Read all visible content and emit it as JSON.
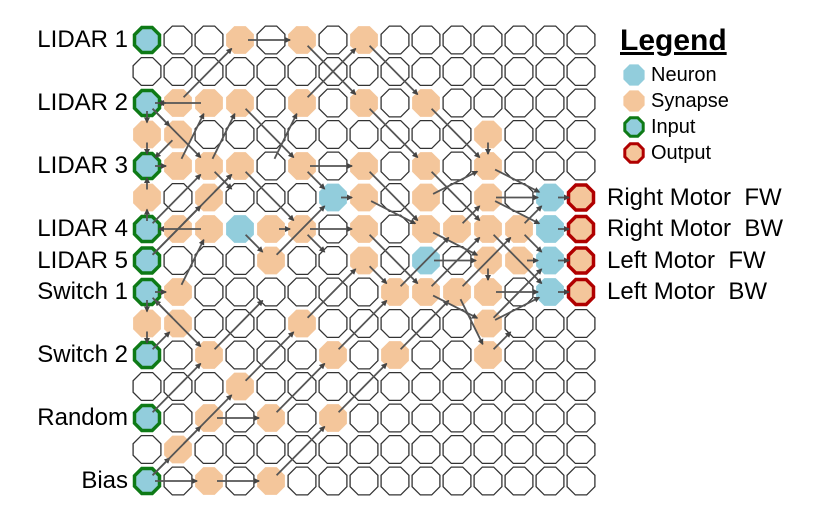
{
  "legend": {
    "title": "Legend",
    "items": [
      {
        "key": "N",
        "label": "Neuron",
        "icon": "neuron-icon"
      },
      {
        "key": "S",
        "label": "Synapse",
        "icon": "synapse-icon"
      },
      {
        "key": "I",
        "label": "Input",
        "icon": "input-icon"
      },
      {
        "key": "O",
        "label": "Output",
        "icon": "output-icon"
      }
    ]
  },
  "colors": {
    "neuron_fill": "#92CDDC",
    "synapse_fill": "#F4C69B",
    "input_border": "#0E7A16",
    "output_border": "#B00000",
    "empty_border": "#333333",
    "edge": "#555555"
  },
  "input_labels": [
    {
      "row": 0,
      "label": "LIDAR 1"
    },
    {
      "row": 2,
      "label": "LIDAR 2"
    },
    {
      "row": 4,
      "label": "LIDAR 3"
    },
    {
      "row": 6,
      "label": "LIDAR 4"
    },
    {
      "row": 7,
      "label": "LIDAR 5"
    },
    {
      "row": 8,
      "label": "Switch 1"
    },
    {
      "row": 10,
      "label": "Switch 2"
    },
    {
      "row": 12,
      "label": "Random"
    },
    {
      "row": 14,
      "label": "Bias"
    }
  ],
  "output_labels": [
    {
      "row": 5,
      "label": "Right Motor  FW"
    },
    {
      "row": 6,
      "label": "Right Motor  BW"
    },
    {
      "row": 7,
      "label": "Left Motor  FW"
    },
    {
      "row": 8,
      "label": "Left Motor  BW"
    }
  ],
  "grid": {
    "rows": 15,
    "cols": 15,
    "cells": [
      "IEESESESEEEEEEE",
      "EEEEEEEEEEEEEEE",
      "ISSSESESESEEEEE",
      "SSEEEEEEEEESEEE",
      "ISSSESESESESEEE",
      "SESEEENSESESENO",
      "ISSNSSESESSSSNO",
      "IEEESEESENESSNO",
      "ISEEEEEESSSSENO",
      "SSEEESEEEEESEEE",
      "IESEEESESEESEEE",
      "EEESEEEEEEEEEEE",
      "IESESESEEEEEEEE",
      "ESEEEEEEEEEEEEE",
      "IESESEEEEEEEEEE"
    ]
  },
  "edges": [
    [
      0,
      3,
      0,
      5
    ],
    [
      2,
      0,
      2,
      1
    ],
    [
      2,
      2,
      2,
      0
    ],
    [
      4,
      0,
      4,
      1
    ],
    [
      4,
      5,
      4,
      7
    ],
    [
      5,
      6,
      5,
      7
    ],
    [
      5,
      11,
      5,
      13
    ],
    [
      6,
      2,
      6,
      0
    ],
    [
      6,
      4,
      6,
      5
    ],
    [
      6,
      5,
      6,
      7
    ],
    [
      7,
      9,
      7,
      11
    ],
    [
      7,
      12,
      7,
      13
    ],
    [
      8,
      0,
      8,
      1
    ],
    [
      8,
      11,
      8,
      13
    ],
    [
      12,
      2,
      12,
      4
    ],
    [
      14,
      0,
      14,
      2
    ],
    [
      14,
      2,
      14,
      4
    ],
    [
      5,
      13,
      5,
      14
    ],
    [
      6,
      13,
      6,
      14
    ],
    [
      7,
      13,
      7,
      14
    ],
    [
      8,
      13,
      8,
      14
    ],
    [
      2,
      0,
      3,
      0
    ],
    [
      3,
      0,
      4,
      0
    ],
    [
      5,
      0,
      4,
      0
    ],
    [
      6,
      0,
      5,
      0
    ],
    [
      8,
      0,
      9,
      0
    ],
    [
      9,
      0,
      10,
      0
    ],
    [
      2,
      1,
      0,
      3
    ],
    [
      4,
      1,
      2,
      2
    ],
    [
      4,
      2,
      2,
      3
    ],
    [
      4,
      4,
      2,
      5
    ],
    [
      2,
      5,
      0,
      7
    ],
    [
      2,
      0,
      4,
      2
    ],
    [
      2,
      0,
      3,
      1
    ],
    [
      3,
      1,
      4,
      0
    ],
    [
      2,
      3,
      4,
      5
    ],
    [
      0,
      5,
      2,
      7
    ],
    [
      0,
      7,
      2,
      9
    ],
    [
      2,
      7,
      4,
      9
    ],
    [
      2,
      9,
      4,
      11
    ],
    [
      3,
      11,
      4,
      11
    ],
    [
      4,
      2,
      5,
      3
    ],
    [
      4,
      3,
      6,
      5
    ],
    [
      4,
      5,
      5,
      6
    ],
    [
      4,
      9,
      6,
      11
    ],
    [
      4,
      11,
      5,
      13
    ],
    [
      4,
      7,
      6,
      9
    ],
    [
      5,
      2,
      4,
      3
    ],
    [
      6,
      1,
      4,
      3
    ],
    [
      7,
      0,
      5,
      2
    ],
    [
      6,
      0,
      4,
      2
    ],
    [
      6,
      3,
      7,
      4
    ],
    [
      7,
      4,
      5,
      6
    ],
    [
      6,
      5,
      7,
      6
    ],
    [
      5,
      7,
      6,
      9
    ],
    [
      6,
      9,
      7,
      11
    ],
    [
      6,
      10,
      5,
      11
    ],
    [
      5,
      9,
      4,
      11
    ],
    [
      7,
      0,
      5,
      2
    ],
    [
      8,
      1,
      6,
      2
    ],
    [
      10,
      0,
      9,
      1
    ],
    [
      9,
      1,
      8,
      0
    ],
    [
      6,
      7,
      8,
      9
    ],
    [
      7,
      7,
      8,
      8
    ],
    [
      8,
      8,
      6,
      10
    ],
    [
      8,
      9,
      6,
      11
    ],
    [
      8,
      10,
      6,
      12
    ],
    [
      6,
      11,
      8,
      13
    ],
    [
      6,
      12,
      7,
      13
    ],
    [
      7,
      11,
      8,
      11
    ],
    [
      9,
      5,
      7,
      7
    ],
    [
      10,
      2,
      8,
      4
    ],
    [
      10,
      6,
      8,
      8
    ],
    [
      11,
      3,
      9,
      5
    ],
    [
      12,
      0,
      10,
      2
    ],
    [
      12,
      4,
      10,
      6
    ],
    [
      12,
      6,
      10,
      8
    ],
    [
      13,
      1,
      11,
      3
    ],
    [
      14,
      0,
      13,
      1
    ],
    [
      14,
      0,
      12,
      2
    ],
    [
      14,
      4,
      12,
      6
    ],
    [
      10,
      8,
      8,
      10
    ],
    [
      9,
      11,
      8,
      13
    ],
    [
      10,
      11,
      9,
      12
    ],
    [
      8,
      10,
      10,
      11
    ],
    [
      8,
      9,
      9,
      11
    ],
    [
      8,
      0,
      10,
      2
    ],
    [
      6,
      12,
      5,
      13
    ],
    [
      5,
      11,
      6,
      13
    ],
    [
      9,
      11,
      7,
      13
    ]
  ]
}
